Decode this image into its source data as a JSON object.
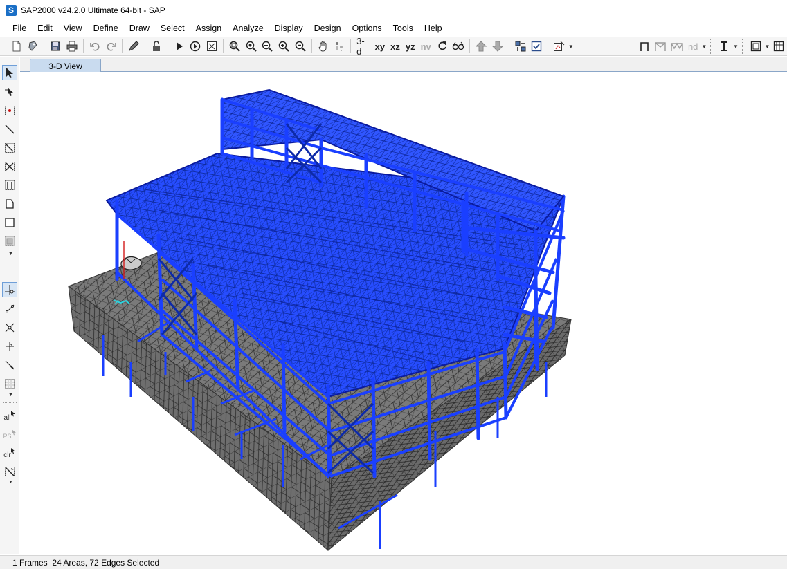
{
  "window": {
    "logo_letter": "S",
    "title": "SAP2000 v24.2.0 Ultimate 64-bit - SAP"
  },
  "menu": [
    "File",
    "Edit",
    "View",
    "Define",
    "Draw",
    "Select",
    "Assign",
    "Analyze",
    "Display",
    "Design",
    "Options",
    "Tools",
    "Help"
  ],
  "toolbar": {
    "view_3d": "3-d",
    "view_xy": "xy",
    "view_xz": "xz",
    "view_yz": "yz",
    "view_nv": "nv",
    "view_nd": "nd"
  },
  "left_toolbar": {
    "select_all": "all",
    "select_prev": "PS",
    "clear_selection": "clr"
  },
  "tabs": [
    {
      "label": "3-D View",
      "active": true
    }
  ],
  "status": {
    "text": "1 Frames  24 Areas, 72 Edges Selected"
  },
  "colors": {
    "frame_selected": "#1a3fff",
    "frame_edge": "#0a1a9e",
    "mesh_face": "#767676",
    "mesh_line": "#2a2a2a",
    "logo_bg": "#1a6fc6"
  }
}
